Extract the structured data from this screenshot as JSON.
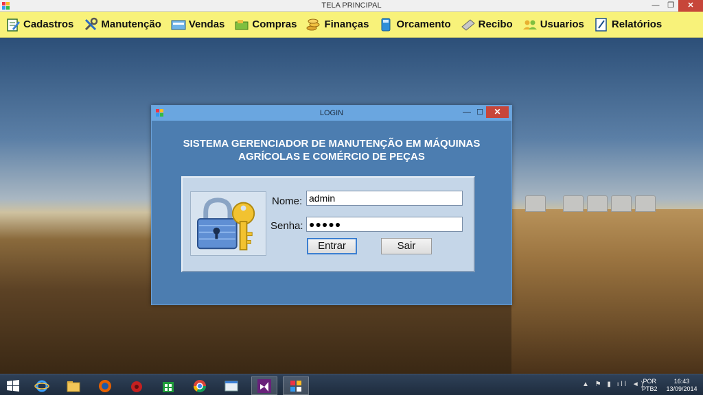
{
  "window": {
    "title": "TELA PRINCIPAL",
    "controls": {
      "minimize": "—",
      "maximize": "❐",
      "close": "✕"
    }
  },
  "menu": {
    "items": [
      {
        "label": "Cadastros",
        "icon": "edit-clipboard-icon"
      },
      {
        "label": "Manutenção",
        "icon": "tools-icon"
      },
      {
        "label": "Vendas",
        "icon": "cash-register-icon"
      },
      {
        "label": "Compras",
        "icon": "cart-icon"
      },
      {
        "label": "Finanças",
        "icon": "coins-icon"
      },
      {
        "label": "Orcamento",
        "icon": "calculator-icon"
      },
      {
        "label": "Recibo",
        "icon": "receipt-icon"
      },
      {
        "label": "Usuarios",
        "icon": "users-icon"
      },
      {
        "label": "Relatórios",
        "icon": "report-icon"
      }
    ]
  },
  "login": {
    "title": "LOGIN",
    "controls": {
      "minimize": "—",
      "maximize": "☐",
      "close": "✕"
    },
    "heading_line1": "SISTEMA GERENCIADOR DE MANUTENÇÃO EM MÁQUINAS",
    "heading_line2": "AGRÍCOLAS E COMÉRCIO DE PEÇAS",
    "nome_label": "Nome:",
    "nome_value": "admin",
    "senha_label": "Senha:",
    "senha_value": "●●●●●",
    "entrar_label": "Entrar",
    "sair_label": "Sair"
  },
  "taskbar": {
    "apps": [
      "windows-start-icon",
      "internet-explorer-icon",
      "file-explorer-icon",
      "firefox-icon",
      "app-red-icon",
      "store-icon",
      "chrome-icon",
      "window-app-icon",
      "visual-studio-icon",
      "winforms-app-icon"
    ],
    "tray_icons": "▲ ⚑ ▮ ıll ◄)",
    "lang_line1": "POR",
    "lang_line2": "PTB2",
    "time": "16:43",
    "date": "13/09/2014"
  },
  "colors": {
    "menubar_bg": "#f8f27a",
    "dialog_bg": "#4c7db0",
    "close_red": "#c7463a"
  }
}
